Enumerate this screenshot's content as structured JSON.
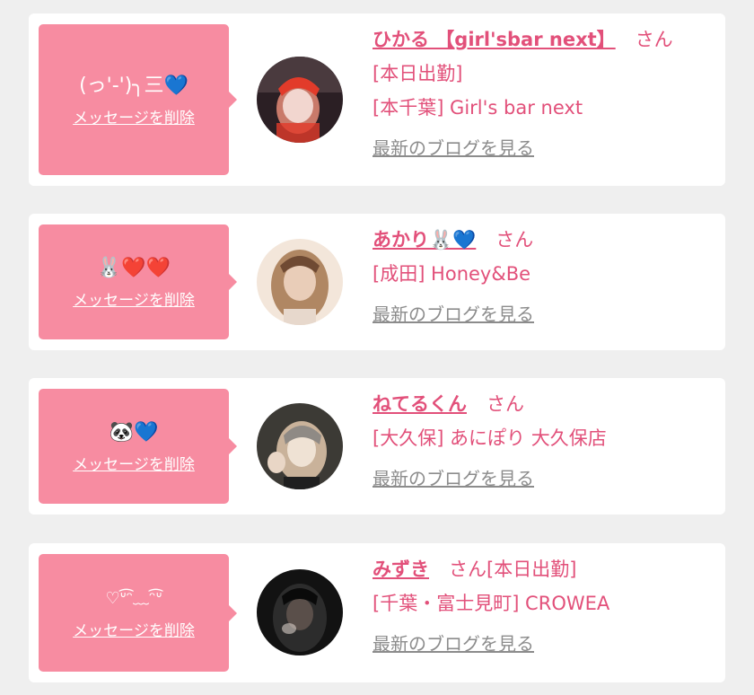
{
  "cards": [
    {
      "message": "(っ'-')╮三💙",
      "delete_label": "メッセージを削除",
      "name": "ひかる 【girl'sbar next】",
      "honorific": "さん",
      "line1": "[本日出勤]",
      "line2": "[本千葉] Girl's bar next",
      "blog_label": "最新のブログを見る",
      "avatar_colors": [
        "#2b1f24",
        "#c97a6a",
        "#e23b2a",
        "#f2d6cf"
      ]
    },
    {
      "message": "🐰❤️❤️",
      "delete_label": "メッセージを削除",
      "name": "あかり🐰💙",
      "honorific": "さん",
      "line1": "[成田] Honey&Be",
      "blog_label": "最新のブログを見る",
      "avatar_colors": [
        "#f3e6da",
        "#b08763",
        "#e9cdb8",
        "#6f4a33"
      ]
    },
    {
      "message": "🐼💙",
      "delete_label": "メッセージを削除",
      "name": "ねてるくん",
      "honorific": "さん",
      "line1": "[大久保] あにぽり 大久保店",
      "blog_label": "最新のブログを見る",
      "avatar_colors": [
        "#3c3a35",
        "#c9b29a",
        "#efe2d4",
        "#1f1f1f"
      ]
    },
    {
      "message": "♡ᐡ͡ᵔ﹏ᵔ͡ᐡ",
      "delete_label": "メッセージを削除",
      "name": "みずき",
      "honorific": "さん[本日出勤]",
      "line1": "[千葉・富士見町] CROWEA",
      "blog_label": "最新のブログを見る",
      "avatar_colors": [
        "#121212",
        "#2c2c2c",
        "#5a4f4a",
        "#d9cfc8"
      ]
    }
  ]
}
